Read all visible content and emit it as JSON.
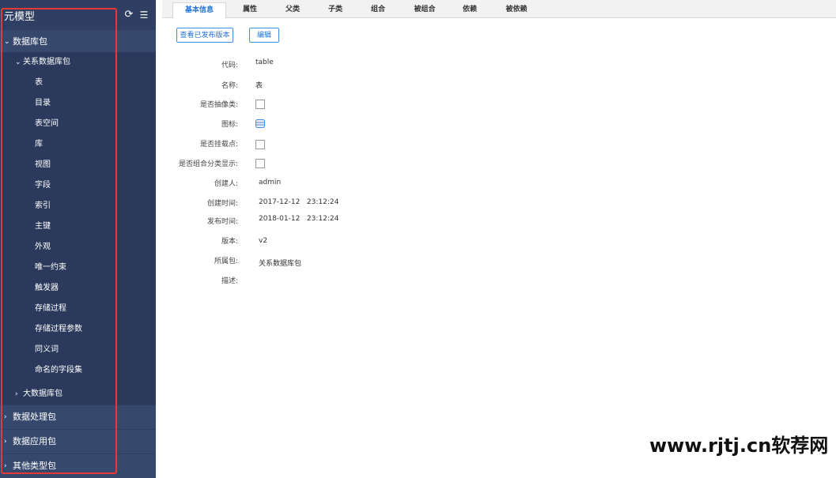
{
  "sidebar": {
    "title": "元模型",
    "groups": [
      {
        "label": "数据库包",
        "expanded": true
      },
      {
        "label": "数据处理包",
        "expanded": false
      },
      {
        "label": "数据应用包",
        "expanded": false
      },
      {
        "label": "其他类型包",
        "expanded": false
      }
    ],
    "subgroups": [
      {
        "label": "关系数据库包",
        "expanded": true
      },
      {
        "label": "大数据库包",
        "expanded": false
      }
    ],
    "items": [
      "表",
      "目录",
      "表空间",
      "库",
      "视图",
      "字段",
      "索引",
      "主键",
      "外观",
      "唯一约束",
      "触发器",
      "存储过程",
      "存储过程参数",
      "同义词",
      "命名的字段集"
    ],
    "chevron_expanded": "⌄",
    "chevron_collapsed": "›"
  },
  "tabs": [
    "基本信息",
    "属性",
    "父类",
    "子类",
    "组合",
    "被组合",
    "依赖",
    "被依赖"
  ],
  "active_tab": 0,
  "buttons": {
    "view_published": "查看已发布版本",
    "edit": "编辑"
  },
  "fields": {
    "code": {
      "label": "代码:",
      "value": "table"
    },
    "name": {
      "label": "名称:",
      "value": "表"
    },
    "is_abstract": {
      "label": "是否抽像类:",
      "checked": false
    },
    "icon": {
      "label": "图标:",
      "icon": "database-icon"
    },
    "is_mount": {
      "label": "是否挂载点:",
      "checked": false
    },
    "is_group_display": {
      "label": "是否组合分类显示:",
      "checked": false
    },
    "creator": {
      "label": "创建人:",
      "value": "admin"
    },
    "created_time": {
      "label": "创建时间:",
      "value": "2017-12-12   23:12:24"
    },
    "published_time": {
      "label": "发布时间:",
      "value": "2018-01-12   23:12:24"
    },
    "version": {
      "label": "版本:",
      "value": "v2"
    },
    "package": {
      "label": "所属包:",
      "value": "关系数据库包"
    },
    "description": {
      "label": "描述:",
      "value": ""
    }
  },
  "watermark": "www.rjtj.cn软荐网",
  "colors": {
    "sidebar_bg": "#2f3f63",
    "accent": "#1f73d8",
    "highlight_box": "#e53935"
  }
}
